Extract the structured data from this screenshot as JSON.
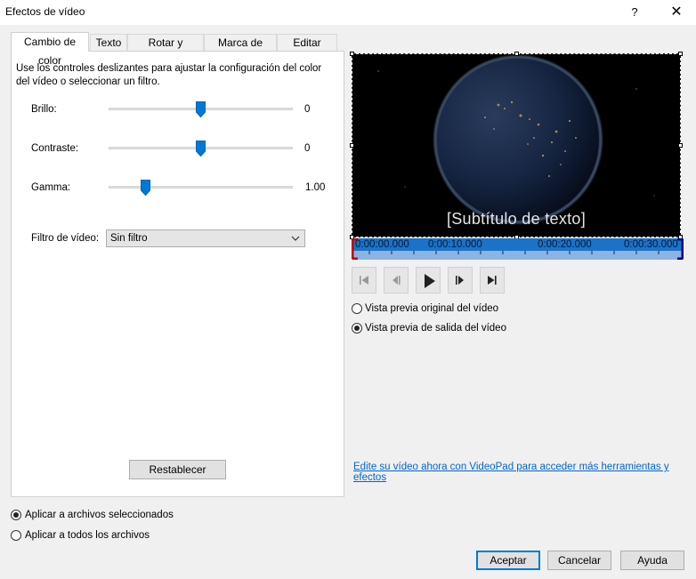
{
  "window": {
    "title": "Efectos de vídeo",
    "help_glyph": "?",
    "close_glyph": "✕"
  },
  "tabs": [
    {
      "label": "Cambio de color",
      "active": true
    },
    {
      "label": "Texto"
    },
    {
      "label": "Rotar y Voltear"
    },
    {
      "label": "Marca de agua"
    },
    {
      "label": "Editar vídeo"
    }
  ],
  "color_panel": {
    "description": "Use los controles deslizantes para ajustar la configuración del color del vídeo o seleccionar un filtro.",
    "sliders": [
      {
        "label": "Brillo:",
        "value": "0",
        "position_fraction": 0.5
      },
      {
        "label": "Contraste:",
        "value": "0",
        "position_fraction": 0.5
      },
      {
        "label": "Gamma:",
        "value": "1.00",
        "position_fraction": 0.2
      }
    ],
    "filter_label": "Filtro de vídeo:",
    "filter_value": "Sin filtro",
    "reset_label": "Restablecer"
  },
  "preview": {
    "subtitle": "[Subtítulo de texto]",
    "timeline_labels": [
      "0:00:00.000",
      "0:00:10.000",
      "0:00:20.000",
      "0:00:30.000"
    ],
    "radio_original": "Vista previa original del vídeo",
    "radio_output": "Vista previa de salida del vídeo",
    "selected_radio": "output",
    "link": "Edite su vídeo ahora con VideoPad para acceder más herramientas y efectos"
  },
  "apply_options": {
    "selected": "Aplicar a archivos seleccionados",
    "all": "Aplicar a todos los archivos"
  },
  "footer": {
    "ok": "Aceptar",
    "cancel": "Cancelar",
    "help": "Ayuda"
  },
  "colors": {
    "accent": "#0078d7",
    "timeline": "#1a73c8",
    "link": "#0066cc"
  },
  "icons": [
    "skip-start-icon",
    "step-back-icon",
    "play-icon",
    "step-forward-icon",
    "skip-end-icon",
    "chevron-down-icon"
  ]
}
